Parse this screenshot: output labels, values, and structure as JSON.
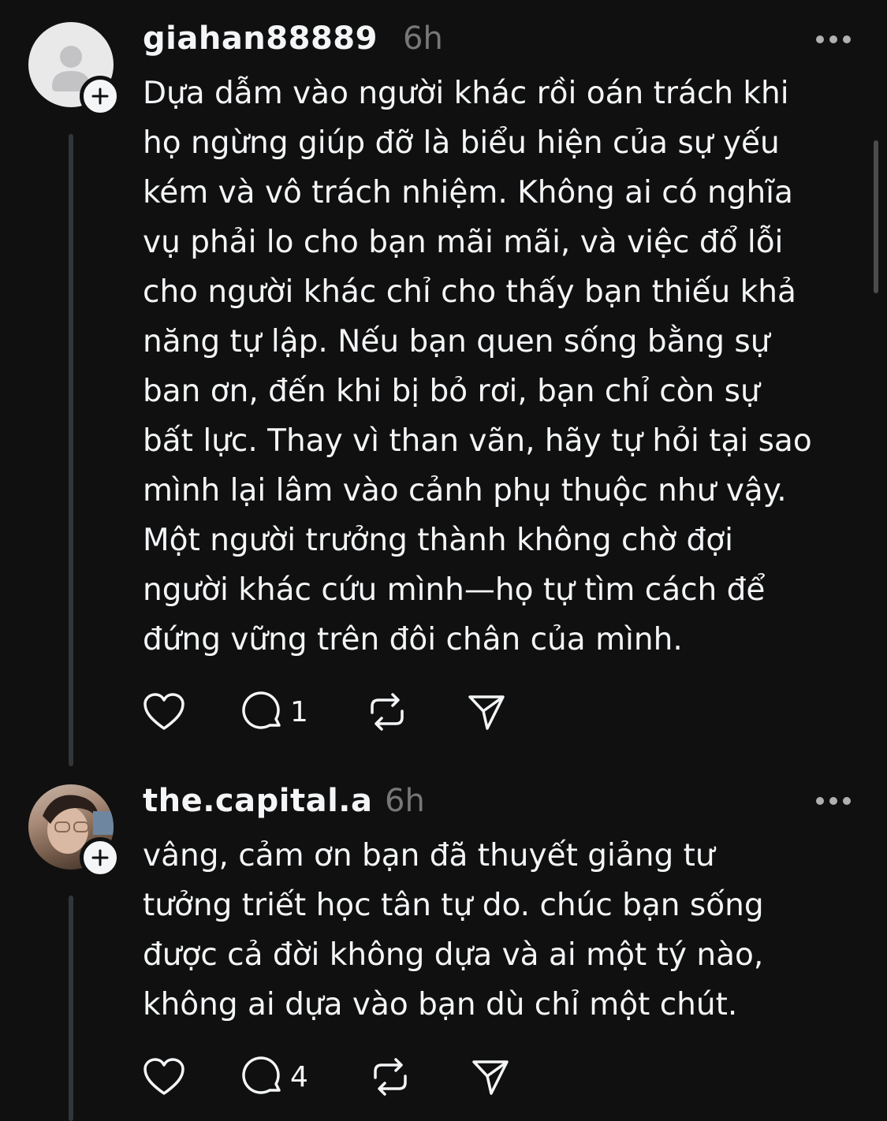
{
  "posts": [
    {
      "username": "giahan88889",
      "time": "6h",
      "text": "Dựa dẫm vào người khác rồi oán trách khi\nhọ ngừng giúp đỡ là biểu hiện của sự yếu\nkém và vô trách nhiệm. Không ai có nghĩa\nvụ phải lo cho bạn mãi mãi, và việc đổ lỗi\ncho người khác chỉ cho thấy bạn thiếu khả\nnăng tự lập. Nếu bạn quen sống bằng sự\nban ơn, đến khi bị bỏ rơi, bạn chỉ còn sự\nbất lực. Thay vì than vãn, hãy tự hỏi tại sao\nmình lại lâm vào cảnh phụ thuộc như vậy.\nMột người trưởng thành không chờ đợi\nngười khác cứu mình—họ tự tìm cách để\nđứng vững trên đôi chân của mình.",
      "reply_count": "1",
      "avatar": "default-avatar-icon"
    },
    {
      "username": "the.capital.a",
      "time": "6h",
      "text": "vâng, cảm ơn bạn đã thuyết giảng tư\ntưởng triết học tân tự do. chúc bạn sống\nđược cả đời không dựa và ai một tý nào,\nkhông ai dựa vào bạn dù chỉ một chút.",
      "reply_count": "4",
      "avatar": "photo-avatar"
    }
  ],
  "colors": {
    "background": "#101010",
    "text": "#f3f5f7",
    "muted": "#777777",
    "line": "#333638"
  },
  "icons": [
    "heart-icon",
    "comment-icon",
    "repost-icon",
    "share-icon",
    "more-icon",
    "plus-icon"
  ]
}
